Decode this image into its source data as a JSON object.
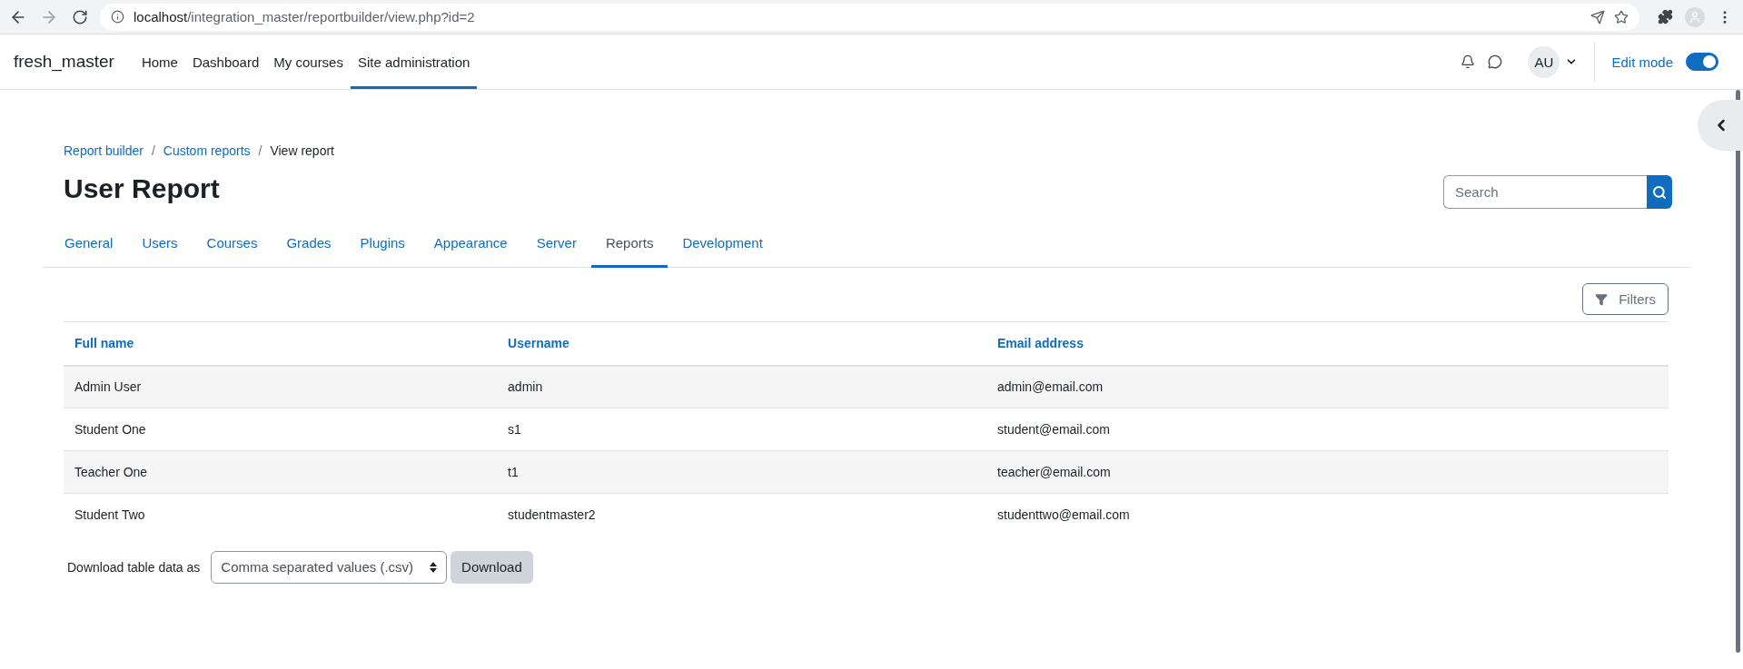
{
  "browser": {
    "url_host": "localhost",
    "url_path": "/integration_master/reportbuilder/view.php?id=2"
  },
  "navbar": {
    "brand": "fresh_master",
    "items": [
      {
        "label": "Home",
        "selected": false
      },
      {
        "label": "Dashboard",
        "selected": false
      },
      {
        "label": "My courses",
        "selected": false
      },
      {
        "label": "Site administration",
        "selected": true
      }
    ],
    "avatar": "AU",
    "edit_mode": {
      "label": "Edit mode",
      "on": true
    }
  },
  "breadcrumb": [
    {
      "label": "Report builder",
      "kind": "link"
    },
    {
      "separator": "/",
      "label": "Custom reports",
      "kind": "link"
    },
    {
      "separator": "/",
      "label": "View report",
      "kind": "current"
    }
  ],
  "page_title": "User Report",
  "search": {
    "placeholder": "Search"
  },
  "tabs": [
    {
      "label": "General",
      "selected": false
    },
    {
      "label": "Users",
      "selected": false
    },
    {
      "label": "Courses",
      "selected": false
    },
    {
      "label": "Grades",
      "selected": false
    },
    {
      "label": "Plugins",
      "selected": false
    },
    {
      "label": "Appearance",
      "selected": false
    },
    {
      "label": "Server",
      "selected": false
    },
    {
      "label": "Reports",
      "selected": true
    },
    {
      "label": "Development",
      "selected": false
    }
  ],
  "filters_button": "Filters",
  "table": {
    "columns": [
      "Full name",
      "Username",
      "Email address"
    ],
    "rows": [
      [
        "Admin User",
        "admin",
        "admin@email.com"
      ],
      [
        "Student One",
        "s1",
        "student@email.com"
      ],
      [
        "Teacher One",
        "t1",
        "teacher@email.com"
      ],
      [
        "Student Two",
        "studentmaster2",
        "studenttwo@email.com"
      ]
    ]
  },
  "download": {
    "label": "Download table data as",
    "format": "Comma separated values (.csv)",
    "button": "Download"
  }
}
